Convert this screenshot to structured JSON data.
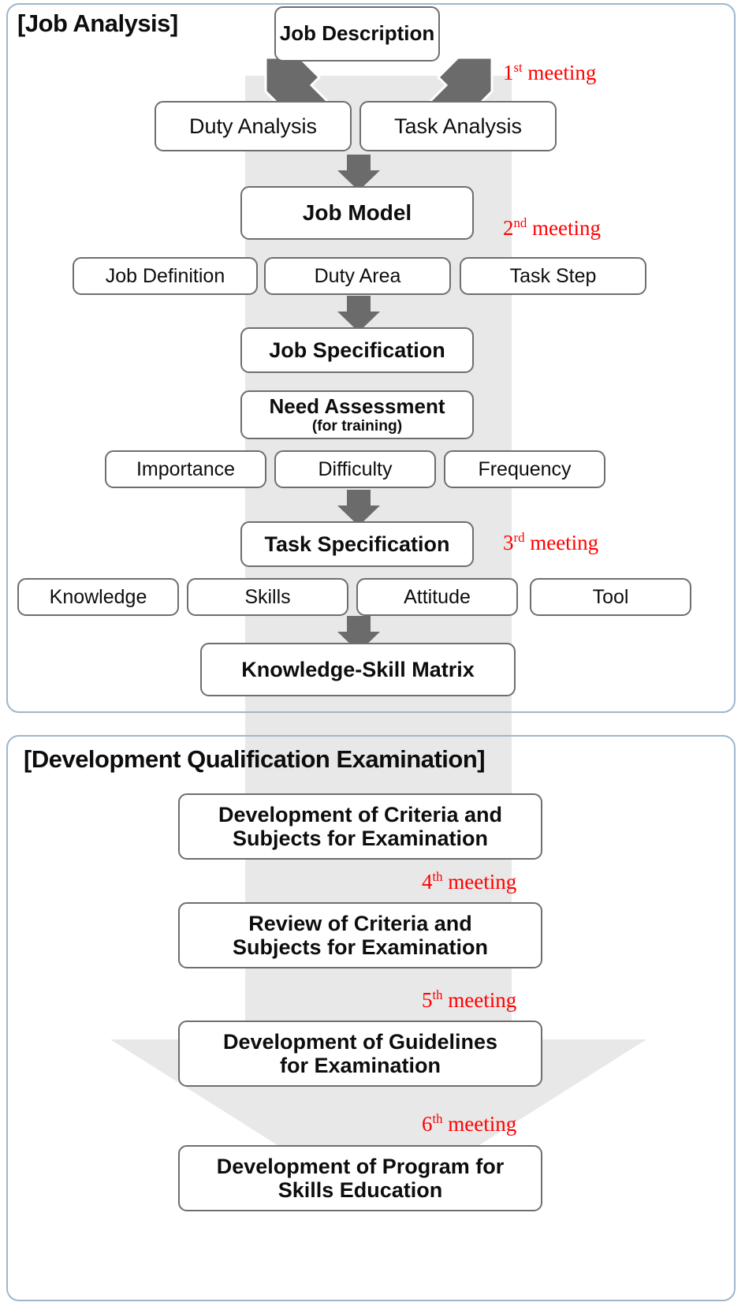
{
  "diagram": {
    "type": "flowchart",
    "sections": [
      {
        "id": "job-analysis",
        "title": "[Job Analysis]"
      },
      {
        "id": "development-qualification-examination",
        "title": "[Development Qualification Examination]"
      }
    ]
  },
  "nodes": {
    "job_description": "Job Description",
    "duty_analysis": "Duty Analysis",
    "task_analysis": "Task Analysis",
    "job_model": "Job Model",
    "job_definition": "Job Definition",
    "duty_area": "Duty Area",
    "task_step": "Task Step",
    "job_specification": "Job Specification",
    "need_assessment_main": "Need Assessment",
    "need_assessment_sub": "(for training)",
    "importance": "Importance",
    "difficulty": "Difficulty",
    "frequency": "Frequency",
    "task_specification": "Task Specification",
    "knowledge": "Knowledge",
    "skills": "Skills",
    "attitude": "Attitude",
    "tool": "Tool",
    "knowledge_skill_matrix": "Knowledge-Skill Matrix",
    "dev_criteria_subjects_l1": "Development of Criteria and",
    "dev_criteria_subjects_l2": "Subjects for Examination",
    "review_criteria_subjects_l1": "Review of Criteria and",
    "review_criteria_subjects_l2": "Subjects for Examination",
    "dev_guidelines_l1": "Development of Guidelines",
    "dev_guidelines_l2": "for Examination",
    "dev_program_l1": "Development of Program for",
    "dev_program_l2": "Skills Education"
  },
  "meetings": [
    {
      "ordinal": "1",
      "suffix": "st",
      "label": " meeting"
    },
    {
      "ordinal": "2",
      "suffix": "nd",
      "label": " meeting"
    },
    {
      "ordinal": "3",
      "suffix": "rd",
      "label": " meeting"
    },
    {
      "ordinal": "4",
      "suffix": "th",
      "label": " meeting"
    },
    {
      "ordinal": "5",
      "suffix": "th",
      "label": " meeting"
    },
    {
      "ordinal": "6",
      "suffix": "th",
      "label": " meeting"
    }
  ],
  "colors": {
    "panel_border": "#9fb6cd",
    "node_border": "#6e6e6e",
    "node_fill": "#ffffff",
    "flow_band": "#e8e8e8",
    "arrow_gray": "#6b6b6b",
    "meeting_text": "#ff0000",
    "text": "#0d0d0d",
    "background": "#ffffff"
  }
}
